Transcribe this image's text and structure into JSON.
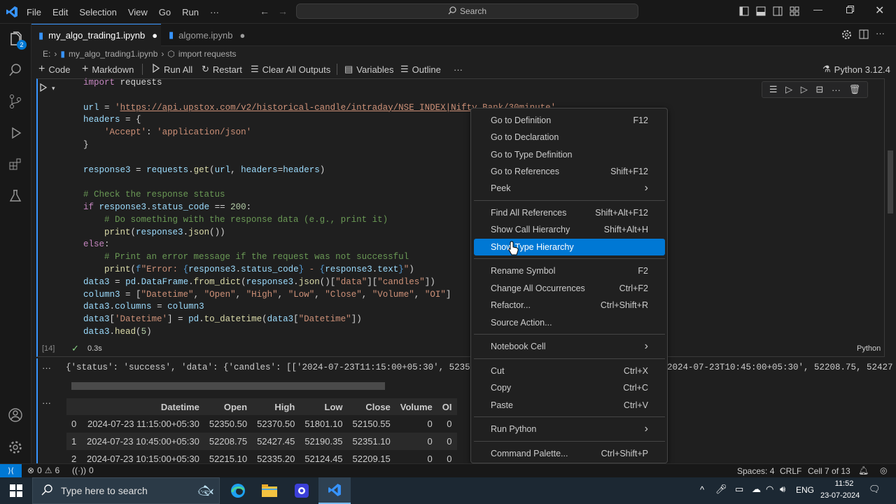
{
  "titlebar": {
    "menu": [
      "File",
      "Edit",
      "Selection",
      "View",
      "Go",
      "Run",
      "···"
    ],
    "search": "Search"
  },
  "tabs": [
    {
      "label": "my_algo_trading1.ipynb"
    },
    {
      "label": "algome.ipynb"
    }
  ],
  "breadcrumb": {
    "drive": "E:",
    "file": "my_algo_trading1.ipynb",
    "symbol": "import requests"
  },
  "toolbar": {
    "code": "Code",
    "markdown": "Markdown",
    "run_all": "Run All",
    "restart": "Restart",
    "clear": "Clear All Outputs",
    "variables": "Variables",
    "outline": "Outline",
    "more": "···",
    "kernel": "Python 3.12.4"
  },
  "cell": {
    "exec_count": "[14]",
    "time": "0.3s",
    "language": "Python"
  },
  "output": {
    "text": "{'status': 'success', 'data': {'candles': [['2024-07-23T11:15:00+05:30', 52350.5",
    "text_right": "2024-07-23T10:45:00+05:30', 52208.75, 52427"
  },
  "table": {
    "columns": [
      "",
      "Datetime",
      "Open",
      "High",
      "Low",
      "Close",
      "Volume",
      "OI"
    ],
    "rows": [
      [
        "0",
        "2024-07-23 11:15:00+05:30",
        "52350.50",
        "52370.50",
        "51801.10",
        "52150.55",
        "0",
        "0"
      ],
      [
        "1",
        "2024-07-23 10:45:00+05:30",
        "52208.75",
        "52427.45",
        "52190.35",
        "52351.10",
        "0",
        "0"
      ],
      [
        "2",
        "2024-07-23 10:15:00+05:30",
        "52215.10",
        "52335.20",
        "52124.45",
        "52209.15",
        "0",
        "0"
      ]
    ]
  },
  "context_menu": [
    {
      "label": "Go to Definition",
      "key": "F12"
    },
    {
      "label": "Go to Declaration",
      "key": ""
    },
    {
      "label": "Go to Type Definition",
      "key": ""
    },
    {
      "label": "Go to References",
      "key": "Shift+F12"
    },
    {
      "label": "Peek",
      "key": "›"
    },
    {
      "label": "Find All References",
      "key": "Shift+Alt+F12"
    },
    {
      "label": "Show Call Hierarchy",
      "key": "Shift+Alt+H"
    },
    {
      "label": "Show Type Hierarchy",
      "key": ""
    },
    {
      "label": "Rename Symbol",
      "key": "F2"
    },
    {
      "label": "Change All Occurrences",
      "key": "Ctrl+F2"
    },
    {
      "label": "Refactor...",
      "key": "Ctrl+Shift+R"
    },
    {
      "label": "Source Action...",
      "key": ""
    },
    {
      "label": "Notebook Cell",
      "key": "›"
    },
    {
      "label": "Cut",
      "key": "Ctrl+X"
    },
    {
      "label": "Copy",
      "key": "Ctrl+C"
    },
    {
      "label": "Paste",
      "key": "Ctrl+V"
    },
    {
      "label": "Run Python",
      "key": "›"
    },
    {
      "label": "Command Palette...",
      "key": "Ctrl+Shift+P"
    }
  ],
  "statusbar": {
    "errors": "0",
    "warnings": "6",
    "ports": "0",
    "spaces": "Spaces: 4",
    "eol": "CRLF",
    "cell": "Cell 7 of 13"
  },
  "taskbar": {
    "search": "Type here to search",
    "lang": "ENG",
    "time": "11:52",
    "date": "23-07-2024"
  },
  "colors": {
    "accent": "#0078d4",
    "status_remote": "#0078d4",
    "cell_border": "#3794ff"
  },
  "badges": {
    "explorer": "2"
  }
}
